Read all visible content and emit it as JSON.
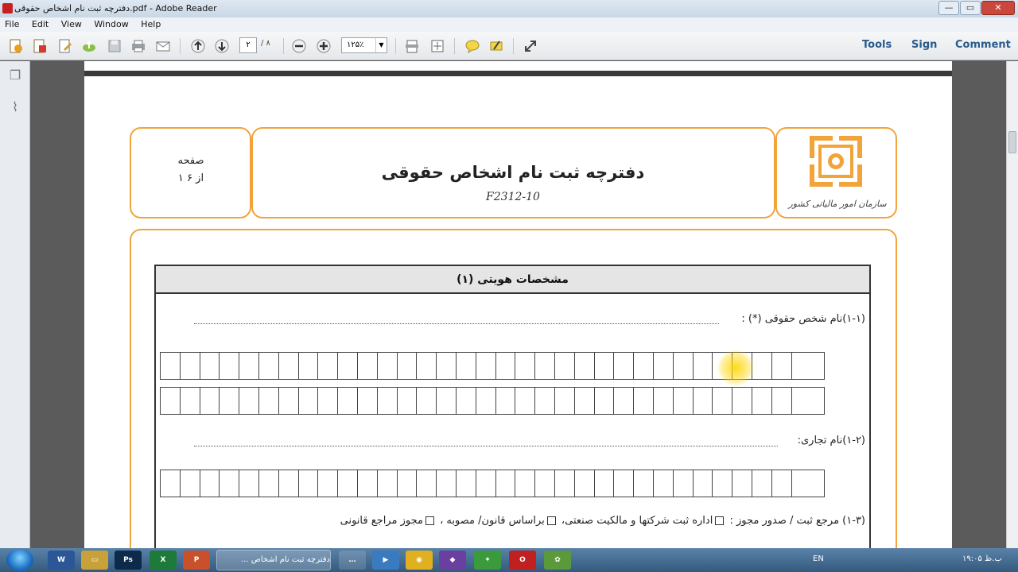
{
  "window": {
    "title": "دفترچه ثبت نام اشخاص حقوقی.pdf - Adobe Reader"
  },
  "menu": {
    "items": [
      "File",
      "Edit",
      "View",
      "Window",
      "Help"
    ]
  },
  "toolbar": {
    "page_current": "۲",
    "page_total": "/ ۸",
    "zoom": "۱۲۵٪",
    "tools": "Tools",
    "sign": "Sign",
    "comment": "Comment"
  },
  "document": {
    "header": {
      "title": "دفترچه ثبت نام اشخاص حقوقی",
      "code": "F2312-10",
      "page_label": "صفحه",
      "page_of": "۱ از ۶",
      "org_name": "سازمان امور مالیاتی کشور"
    },
    "section": {
      "title": "(۱)  مشخصات هویتی"
    },
    "fields": {
      "legal_name": "(۱-۱)نام شخص حقوقی (*) :",
      "trade_name": "(۱-۲)نام تجاری:",
      "registry": "(۱-۳) مرجع ثبت / صدور مجوز :",
      "registry_opt1": "اداره ثبت  شرکتها و مالکیت صنعتی،",
      "registry_opt2": "براساس قانون/ مصوبه ،",
      "registry_opt3": "مجوز مراجع قانونی"
    }
  },
  "taskbar": {
    "active_window": "دفترچه ثبت نام اشخاص ...",
    "lang": "EN",
    "clock": "۱۹:۰۵ ب.ظ"
  },
  "colors": {
    "accent_orange": "#f2a33a",
    "link_blue": "#2a5b8c"
  }
}
